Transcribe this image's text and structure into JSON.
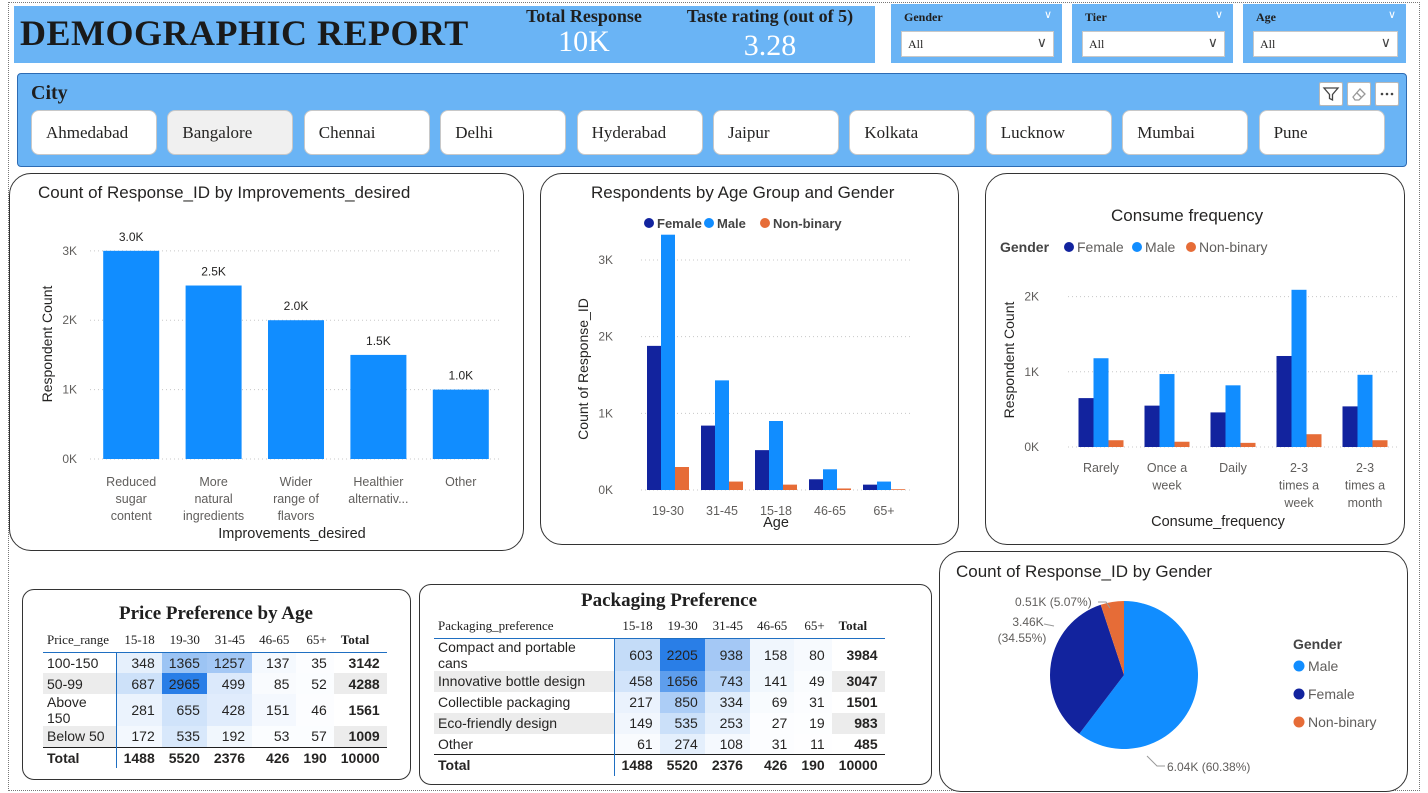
{
  "header": {
    "title": "DEMOGRAPHIC REPORT",
    "kpis": [
      {
        "label": "Total Response",
        "value": "10K"
      },
      {
        "label": "Taste rating (out of 5)",
        "value": "3.28"
      }
    ],
    "slicers": [
      {
        "label": "Gender",
        "value": "All"
      },
      {
        "label": "Tier",
        "value": "All"
      },
      {
        "label": "Age",
        "value": "All"
      }
    ]
  },
  "city_slicer": {
    "title": "City",
    "items": [
      "Ahmedabad",
      "Bangalore",
      "Chennai",
      "Delhi",
      "Hyderabad",
      "Jaipur",
      "Kolkata",
      "Lucknow",
      "Mumbai",
      "Pune"
    ],
    "selected": "Bangalore"
  },
  "colors": {
    "female": "#12239e",
    "male": "#118dff",
    "nonbinary": "#e66c37",
    "header": "#6ab4f5"
  },
  "improvements_chart": {
    "title": "Count of Response_ID by Improvements_desired",
    "chart_data": {
      "type": "bar",
      "categories": [
        "Reduced sugar content",
        "More natural ingredients",
        "Wider range of flavors",
        "Healthier alternativ...",
        "Other"
      ],
      "values": [
        3000,
        2500,
        2000,
        1500,
        1000
      ],
      "data_labels": [
        "3.0K",
        "2.5K",
        "2.0K",
        "1.5K",
        "1.0K"
      ],
      "xlabel": "Improvements_desired",
      "ylabel": "Respondent Count",
      "yticks": [
        "0K",
        "1K",
        "2K",
        "3K"
      ],
      "ylim": [
        0,
        3300
      ]
    }
  },
  "age_gender_chart": {
    "title": "Respondents by Age Group and Gender",
    "chart_data": {
      "type": "bar",
      "categories": [
        "19-30",
        "31-45",
        "15-18",
        "46-65",
        "65+"
      ],
      "series": [
        {
          "name": "Female",
          "values": [
            1880,
            840,
            520,
            140,
            70
          ]
        },
        {
          "name": "Male",
          "values": [
            3330,
            1430,
            900,
            270,
            110
          ]
        },
        {
          "name": "Non-binary",
          "values": [
            300,
            110,
            70,
            20,
            10
          ]
        }
      ],
      "xlabel": "Age",
      "ylabel": "Count of Response_ID",
      "yticks": [
        "0K",
        "1K",
        "2K",
        "3K"
      ],
      "ylim": [
        0,
        3600
      ],
      "legend": "top"
    }
  },
  "consume_chart": {
    "title": "Consume frequency",
    "legend_title": "Gender",
    "chart_data": {
      "type": "bar",
      "categories": [
        "Rarely",
        "Once a week",
        "Daily",
        "2-3 times a week",
        "2-3 times a month"
      ],
      "category_lines": [
        [
          "Rarely"
        ],
        [
          "Once a",
          "week"
        ],
        [
          "Daily"
        ],
        [
          "2-3",
          "times a",
          "week"
        ],
        [
          "2-3",
          "times a",
          "month"
        ]
      ],
      "series": [
        {
          "name": "Female",
          "values": [
            650,
            550,
            460,
            1210,
            540
          ]
        },
        {
          "name": "Male",
          "values": [
            1180,
            970,
            820,
            2090,
            960
          ]
        },
        {
          "name": "Non-binary",
          "values": [
            90,
            70,
            55,
            170,
            90
          ]
        }
      ],
      "xlabel": "Consume_frequency",
      "ylabel": "Respondent Count",
      "yticks": [
        "0K",
        "1K",
        "2K"
      ],
      "ylim": [
        0,
        2300
      ],
      "legend": "top"
    }
  },
  "price_table": {
    "title": "Price Preference by Age",
    "columns": [
      "Price_range",
      "15-18",
      "19-30",
      "31-45",
      "46-65",
      "65+",
      "Total"
    ],
    "rows": [
      {
        "name": "100-150",
        "values": [
          348,
          1365,
          1257,
          137,
          35
        ],
        "total": 3142
      },
      {
        "name": "50-99",
        "values": [
          687,
          2965,
          499,
          85,
          52
        ],
        "total": 4288
      },
      {
        "name": "Above 150",
        "values": [
          281,
          655,
          428,
          151,
          46
        ],
        "total": 1561
      },
      {
        "name": "Below 50",
        "values": [
          172,
          535,
          192,
          53,
          57
        ],
        "total": 1009
      }
    ],
    "total_row": {
      "name": "Total",
      "values": [
        1488,
        5520,
        2376,
        426,
        190
      ],
      "total": 10000
    }
  },
  "packaging_table": {
    "title": "Packaging Preference",
    "columns": [
      "Packaging_preference",
      "15-18",
      "19-30",
      "31-45",
      "46-65",
      "65+",
      "Total"
    ],
    "rows": [
      {
        "name": "Compact and portable cans",
        "values": [
          603,
          2205,
          938,
          158,
          80
        ],
        "total": 3984
      },
      {
        "name": "Innovative bottle design",
        "values": [
          458,
          1656,
          743,
          141,
          49
        ],
        "total": 3047
      },
      {
        "name": "Collectible packaging",
        "values": [
          217,
          850,
          334,
          69,
          31
        ],
        "total": 1501
      },
      {
        "name": "Eco-friendly design",
        "values": [
          149,
          535,
          253,
          27,
          19
        ],
        "total": 983
      },
      {
        "name": "Other",
        "values": [
          61,
          274,
          108,
          31,
          11
        ],
        "total": 485
      }
    ],
    "total_row": {
      "name": "Total",
      "values": [
        1488,
        5520,
        2376,
        426,
        190
      ],
      "total": 10000
    }
  },
  "gender_pie": {
    "title": "Count of Response_ID by Gender",
    "legend_title": "Gender",
    "chart_data": {
      "type": "pie",
      "slices": [
        {
          "name": "Male",
          "value": 6040,
          "percent": 60.38,
          "label": "6.04K (60.38%)"
        },
        {
          "name": "Female",
          "value": 3460,
          "percent": 34.55,
          "label": "3.46K (34.55%)"
        },
        {
          "name": "Non-binary",
          "value": 510,
          "percent": 5.07,
          "label": "0.51K (5.07%)"
        }
      ],
      "legend": "right"
    }
  }
}
